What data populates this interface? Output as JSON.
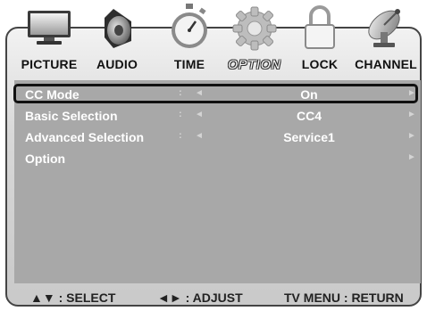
{
  "tabs": [
    {
      "label": "PICTURE",
      "icon": "monitor-icon"
    },
    {
      "label": "AUDIO",
      "icon": "speaker-icon"
    },
    {
      "label": "TIME",
      "icon": "stopwatch-icon"
    },
    {
      "label": "OPTION",
      "icon": "gear-icon",
      "active": true
    },
    {
      "label": "LOCK",
      "icon": "padlock-icon"
    },
    {
      "label": "CHANNEL",
      "icon": "satellite-dish-icon"
    }
  ],
  "rows": [
    {
      "name": "CC Mode",
      "colon": ":",
      "left_arrow": "◄",
      "value": "On",
      "right_arrow": "►",
      "selected": true
    },
    {
      "name": "Basic Selection",
      "colon": ":",
      "left_arrow": "◄",
      "value": "CC4",
      "right_arrow": "►"
    },
    {
      "name": "Advanced Selection",
      "colon": ":",
      "left_arrow": "◄",
      "value": "Service1",
      "right_arrow": "►"
    },
    {
      "name": "Option",
      "colon": "",
      "left_arrow": "",
      "value": "",
      "right_arrow": "►"
    }
  ],
  "footer": {
    "select_hint": "▲▼ : SELECT",
    "adjust_hint": "◄► : ADJUST",
    "return_hint": "TV MENU : RETURN"
  },
  "colors": {
    "panel": "#a8a8a8",
    "frame_border": "#444444",
    "selection_border": "#111111"
  }
}
